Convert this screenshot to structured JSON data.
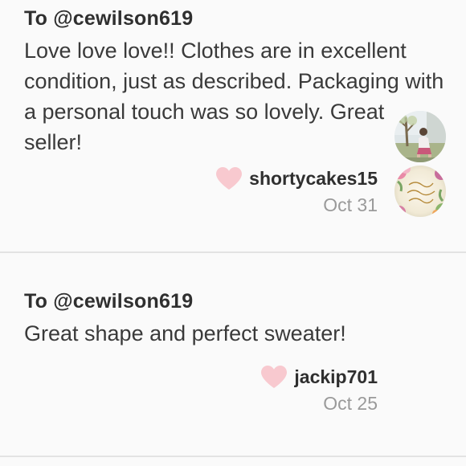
{
  "reviews": [
    {
      "recipient": "To @cewilson619",
      "text": "Love love love!! Clothes are in excellent condition, just as described. Packaging with a personal touch was so lovely. Great seller!",
      "author": "shortycakes15",
      "date": "Oct 31",
      "heart_icon": "heart-icon",
      "avatar_icon": "floral-script-avatar"
    },
    {
      "recipient": "To @cewilson619",
      "text": "Great shape and perfect sweater!",
      "author": "jackip701",
      "date": "Oct 25",
      "heart_icon": "heart-icon",
      "avatar_icon": "outdoor-photo-avatar"
    }
  ],
  "colors": {
    "background": "#fafafa",
    "heart": "#f8c9cf",
    "text_primary": "#2f2f2f",
    "text_muted": "#9a9a9a",
    "divider": "#e3e3e3"
  }
}
